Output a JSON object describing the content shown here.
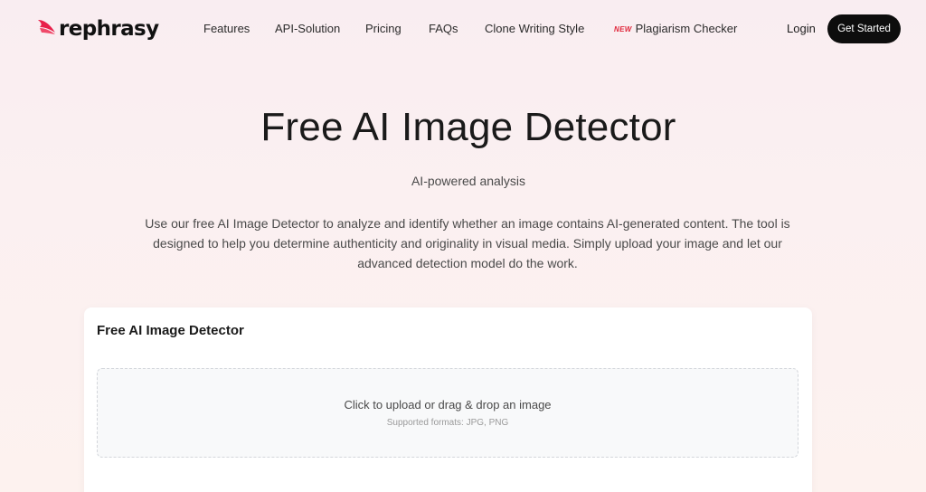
{
  "header": {
    "logo_text": "rephrasy",
    "nav": [
      {
        "label": "Features"
      },
      {
        "label": "API-Solution"
      },
      {
        "label": "Pricing"
      },
      {
        "label": "FAQs"
      },
      {
        "label": "Clone Writing Style"
      },
      {
        "label": "Plagiarism Checker",
        "badge": "NEW"
      }
    ],
    "login_label": "Login",
    "cta_label": "Get Started"
  },
  "hero": {
    "title": "Free AI Image Detector",
    "subtitle": "AI-powered analysis",
    "description": "Use our free AI Image Detector to analyze and identify whether an image contains AI-generated content. The tool is designed to help you determine authenticity and originality in visual media. Simply upload your image and let our advanced detection model do the work."
  },
  "card": {
    "title": "Free AI Image Detector",
    "dropzone": {
      "main_text": "Click to upload or drag & drop an image",
      "hint_text": "Supported formats: JPG, PNG"
    }
  },
  "colors": {
    "brand_accent": "#e8204a",
    "cta_background": "#0d0d0d",
    "new_badge": "#e0263a"
  },
  "icons": {
    "logo_mark": "feather-swoosh-icon"
  }
}
